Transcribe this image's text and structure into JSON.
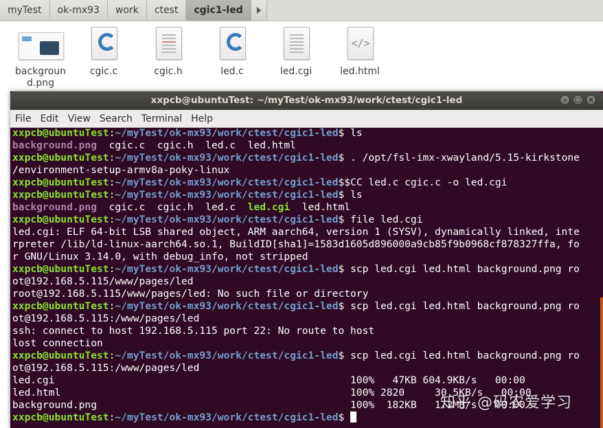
{
  "breadcrumb": {
    "items": [
      "myTest",
      "ok-mx93",
      "work",
      "ctest",
      "cgic1-led"
    ]
  },
  "files": [
    {
      "name": "backgroun\nd.png",
      "icon": "image-thumbnail-icon"
    },
    {
      "name": "cgic.c",
      "icon": "c-source-icon"
    },
    {
      "name": "cgic.h",
      "icon": "c-header-icon"
    },
    {
      "name": "led.c",
      "icon": "c-source-icon"
    },
    {
      "name": "led.cgi",
      "icon": "text-file-icon"
    },
    {
      "name": "led.html",
      "icon": "html-file-icon"
    }
  ],
  "terminal": {
    "title": "xxpcb@ubuntuTest: ~/myTest/ok-mx93/work/ctest/cgic1-led",
    "menu": [
      "File",
      "Edit",
      "View",
      "Search",
      "Terminal",
      "Help"
    ],
    "user_host": "xxpcb@ubuntuTest",
    "path": "~/myTest/ok-mx93/work/ctest/cgic1-led",
    "cmd_ls": "ls",
    "cmd_source": ". /opt/fsl-imx-xwayland/5.15-kirkstone",
    "cmd_source_cont": "/environment-setup-armv8a-poky-linux",
    "cmd_cc": "$CC led.c cgic.c -o led.cgi",
    "cmd_file": "file led.cgi",
    "cmd_scp1": "scp led.cgi led.html background.png ro",
    "cmd_scp1_cont": "ot@192.168.5.115/www/pages/led",
    "cmd_scp2": "scp led.cgi led.html background.png ro",
    "cmd_scp2_cont": "ot@192.168.5.115:/www/pages/led",
    "ls1": {
      "png": "background.png",
      "rest": "  cgic.c  cgic.h  led.c  led.html"
    },
    "ls2": {
      "png": "background.png",
      "mid": "  cgic.c  cgic.h  led.c  ",
      "exe": "led.cgi",
      "rest": "  led.html"
    },
    "file_out": [
      "led.cgi: ELF 64-bit LSB shared object, ARM aarch64, version 1 (SYSV), dynamically linked, inte",
      "rpreter /lib/ld-linux-aarch64.so.1, BuildID[sha1]=1583d1605d896000a9cb85f9b0968cf878327ffa, fo",
      "r GNU/Linux 3.14.0, with debug_info, not stripped"
    ],
    "scp_err1": "root@192.168.5.115/www/pages/led: No such file or directory",
    "scp_err2": [
      "ssh: connect to host 192.168.5.115 port 22: No route to host",
      "lost connection"
    ],
    "transfer": [
      "led.cgi                                                 100%   47KB 604.9KB/s   00:00",
      "led.html                                                100% 2820     30.5KB/s   00:00",
      "background.png                                          100%  182KB   1.2MB/s   00:00"
    ]
  },
  "watermark": "知乎 @码农爱学习"
}
